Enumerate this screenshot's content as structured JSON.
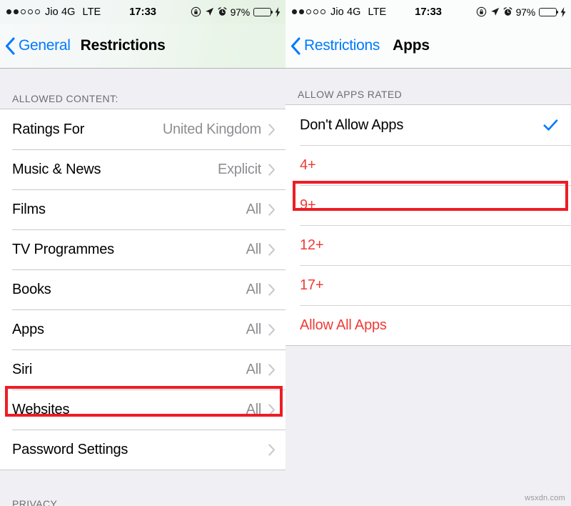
{
  "statusbar": {
    "signal_dots_filled": 2,
    "signal_dots_total": 5,
    "carrier": "Jio 4G",
    "network": "LTE",
    "time": "17:33",
    "battery_percent": "97%",
    "battery_level": 97,
    "icons": [
      "rotation-lock-icon",
      "location-arrow-icon",
      "alarm-clock-icon",
      "battery-icon",
      "charging-bolt-icon"
    ]
  },
  "left_screen": {
    "nav": {
      "back_label": "General",
      "title": "Restrictions"
    },
    "section_header": "ALLOWED CONTENT:",
    "rows": [
      {
        "label": "Ratings For",
        "detail": "United Kingdom",
        "chevron": true,
        "highlighted": false
      },
      {
        "label": "Music & News",
        "detail": "Explicit",
        "chevron": true,
        "highlighted": false
      },
      {
        "label": "Films",
        "detail": "All",
        "chevron": true,
        "highlighted": false
      },
      {
        "label": "TV Programmes",
        "detail": "All",
        "chevron": true,
        "highlighted": false
      },
      {
        "label": "Books",
        "detail": "All",
        "chevron": true,
        "highlighted": false
      },
      {
        "label": "Apps",
        "detail": "All",
        "chevron": true,
        "highlighted": true
      },
      {
        "label": "Siri",
        "detail": "All",
        "chevron": true,
        "highlighted": false
      },
      {
        "label": "Websites",
        "detail": "All",
        "chevron": true,
        "highlighted": false
      },
      {
        "label": "Password Settings",
        "detail": "",
        "chevron": true,
        "highlighted": false
      }
    ],
    "next_section_header": "PRIVACY"
  },
  "right_screen": {
    "nav": {
      "back_label": "Restrictions",
      "title": "Apps"
    },
    "section_header": "ALLOW APPS RATED",
    "rows": [
      {
        "label": "Don't Allow Apps",
        "style": "dark",
        "selected": true,
        "highlighted": true
      },
      {
        "label": "4+",
        "style": "red",
        "selected": false,
        "highlighted": false
      },
      {
        "label": "9+",
        "style": "red",
        "selected": false,
        "highlighted": false
      },
      {
        "label": "12+",
        "style": "red",
        "selected": false,
        "highlighted": false
      },
      {
        "label": "17+",
        "style": "red",
        "selected": false,
        "highlighted": false
      },
      {
        "label": "Allow All Apps",
        "style": "red",
        "selected": false,
        "highlighted": false
      }
    ]
  },
  "watermark": "wsxdn.com",
  "colors": {
    "ios_blue": "#007aff",
    "highlight_red": "#ee1c25",
    "row_red_text": "#ef3b36",
    "detail_gray": "#8e8e93",
    "group_background": "#efeff4",
    "battery_green": "#35c759"
  }
}
